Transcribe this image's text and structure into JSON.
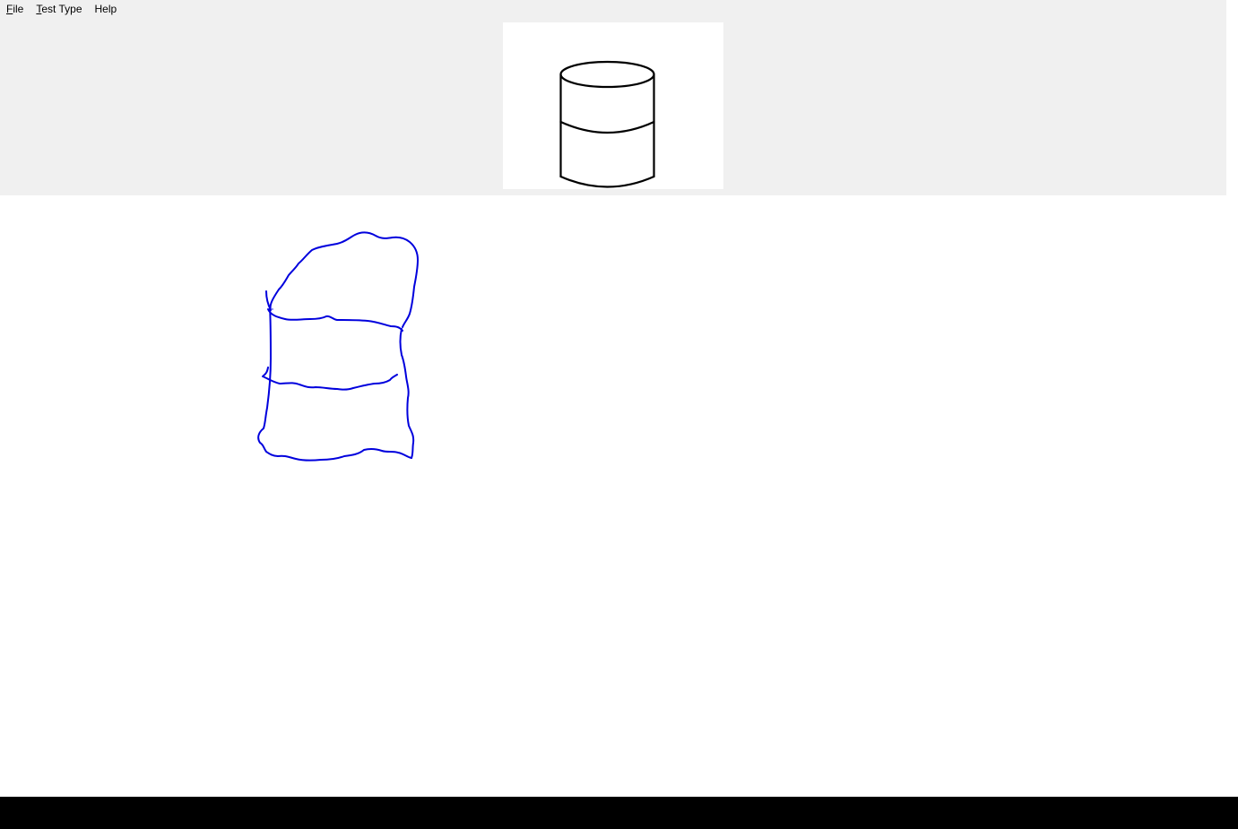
{
  "menu": {
    "file": {
      "accel": "F",
      "rest": "ile"
    },
    "test_type": {
      "accel": "T",
      "rest": "est Type"
    },
    "help": {
      "accel": "",
      "rest": "Help"
    }
  },
  "reference_shape": {
    "icon": "cylinder-icon",
    "stroke_color": "#000000"
  },
  "user_drawing": {
    "stroke_color": "#0000dd"
  },
  "colors": {
    "toolbar_bg": "#f0f0f0",
    "canvas_bg": "#ffffff",
    "bottom_bar": "#000000"
  }
}
